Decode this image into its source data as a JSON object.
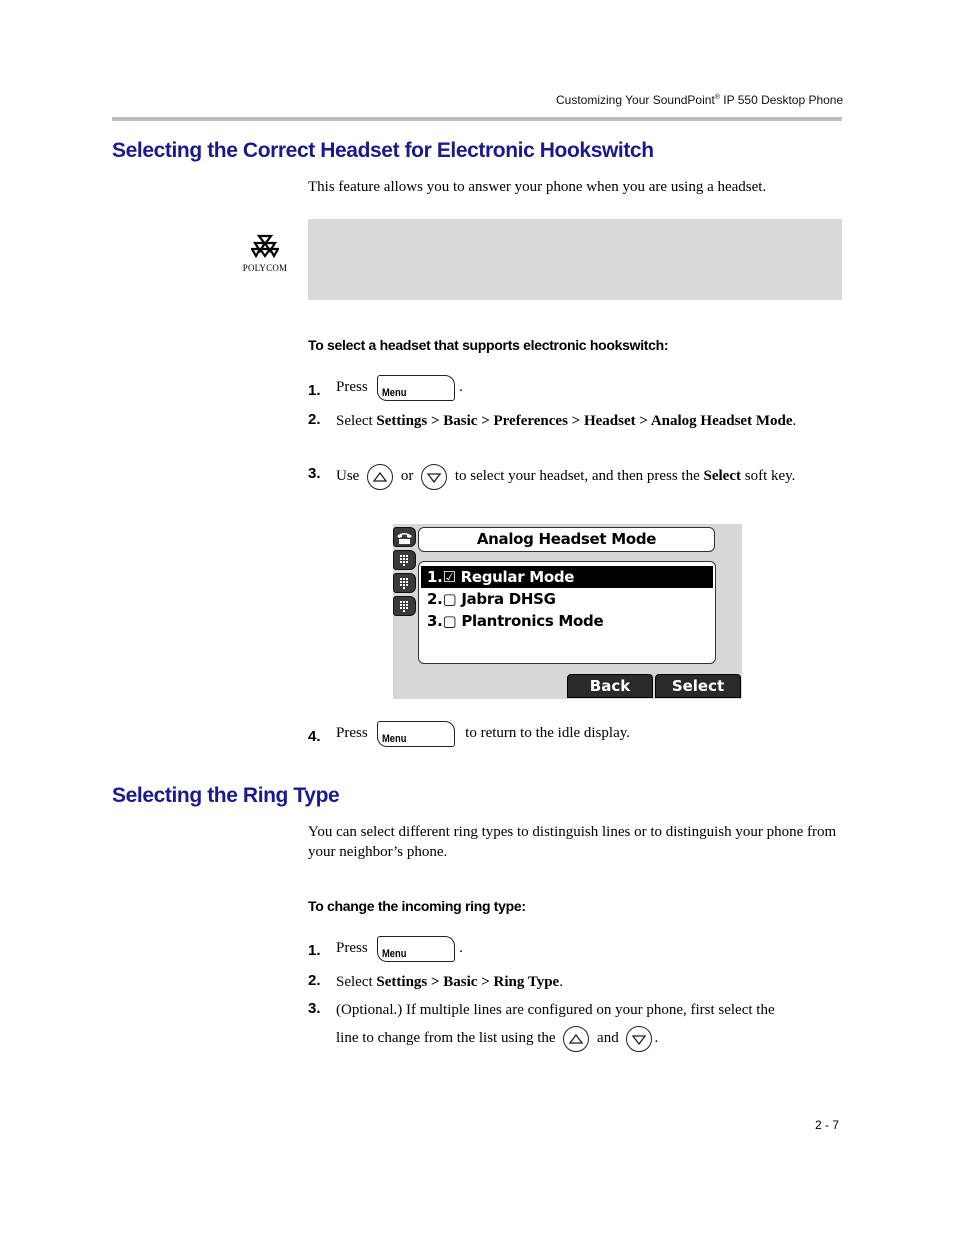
{
  "running_header": {
    "prefix": "Customizing Your SoundPoint",
    "reg": "®",
    "suffix": " IP 550 Desktop Phone"
  },
  "section1": {
    "title": "Selecting the Correct Headset for Electronic Hookswitch",
    "intro": "This feature allows you to answer your phone when you are using a headset.",
    "note_logo": "POLYCOM",
    "procedure_title": "To select a headset that supports electronic hookswitch:",
    "steps": [
      {
        "num": "1.",
        "pre": "Press",
        "key": "Menu",
        "post": "."
      },
      {
        "num": "2.",
        "pre": "Select ",
        "path": "Settings > Basic > Preferences > Headset > Analog Headset Mode",
        "post": "."
      },
      {
        "num": "3.",
        "pre": "Use",
        "mid": "or",
        "post1": "to select your headset, and then press the ",
        "bold": "Select",
        "post2": " soft key."
      },
      {
        "num": "4.",
        "pre": "Press",
        "key": "Menu",
        "post": "to return to the idle display."
      }
    ]
  },
  "phone_screen": {
    "title": "Analog Headset Mode",
    "items": [
      {
        "label": "1.☑ Regular Mode",
        "selected": true
      },
      {
        "label": "2.▢ Jabra DHSG",
        "selected": false
      },
      {
        "label": "3.▢ Plantronics Mode",
        "selected": false
      }
    ],
    "softkeys": [
      "Back",
      "Select"
    ]
  },
  "section2": {
    "title": "Selecting the Ring Type",
    "intro": "You can select different ring types to distinguish lines or to distinguish your phone from your neighbor’s phone.",
    "procedure_title": "To change the incoming ring type:",
    "steps": [
      {
        "num": "1.",
        "pre": "Press",
        "key": "Menu",
        "post": "."
      },
      {
        "num": "2.",
        "pre": "Select ",
        "path": "Settings > Basic > Ring Type",
        "post": "."
      },
      {
        "num": "3.",
        "line1": "(Optional.) If multiple lines are configured on your phone, first select the",
        "line2": "line to change from the list using the",
        "mid": "and",
        "post": "."
      }
    ]
  },
  "page_number": "2 - 7"
}
